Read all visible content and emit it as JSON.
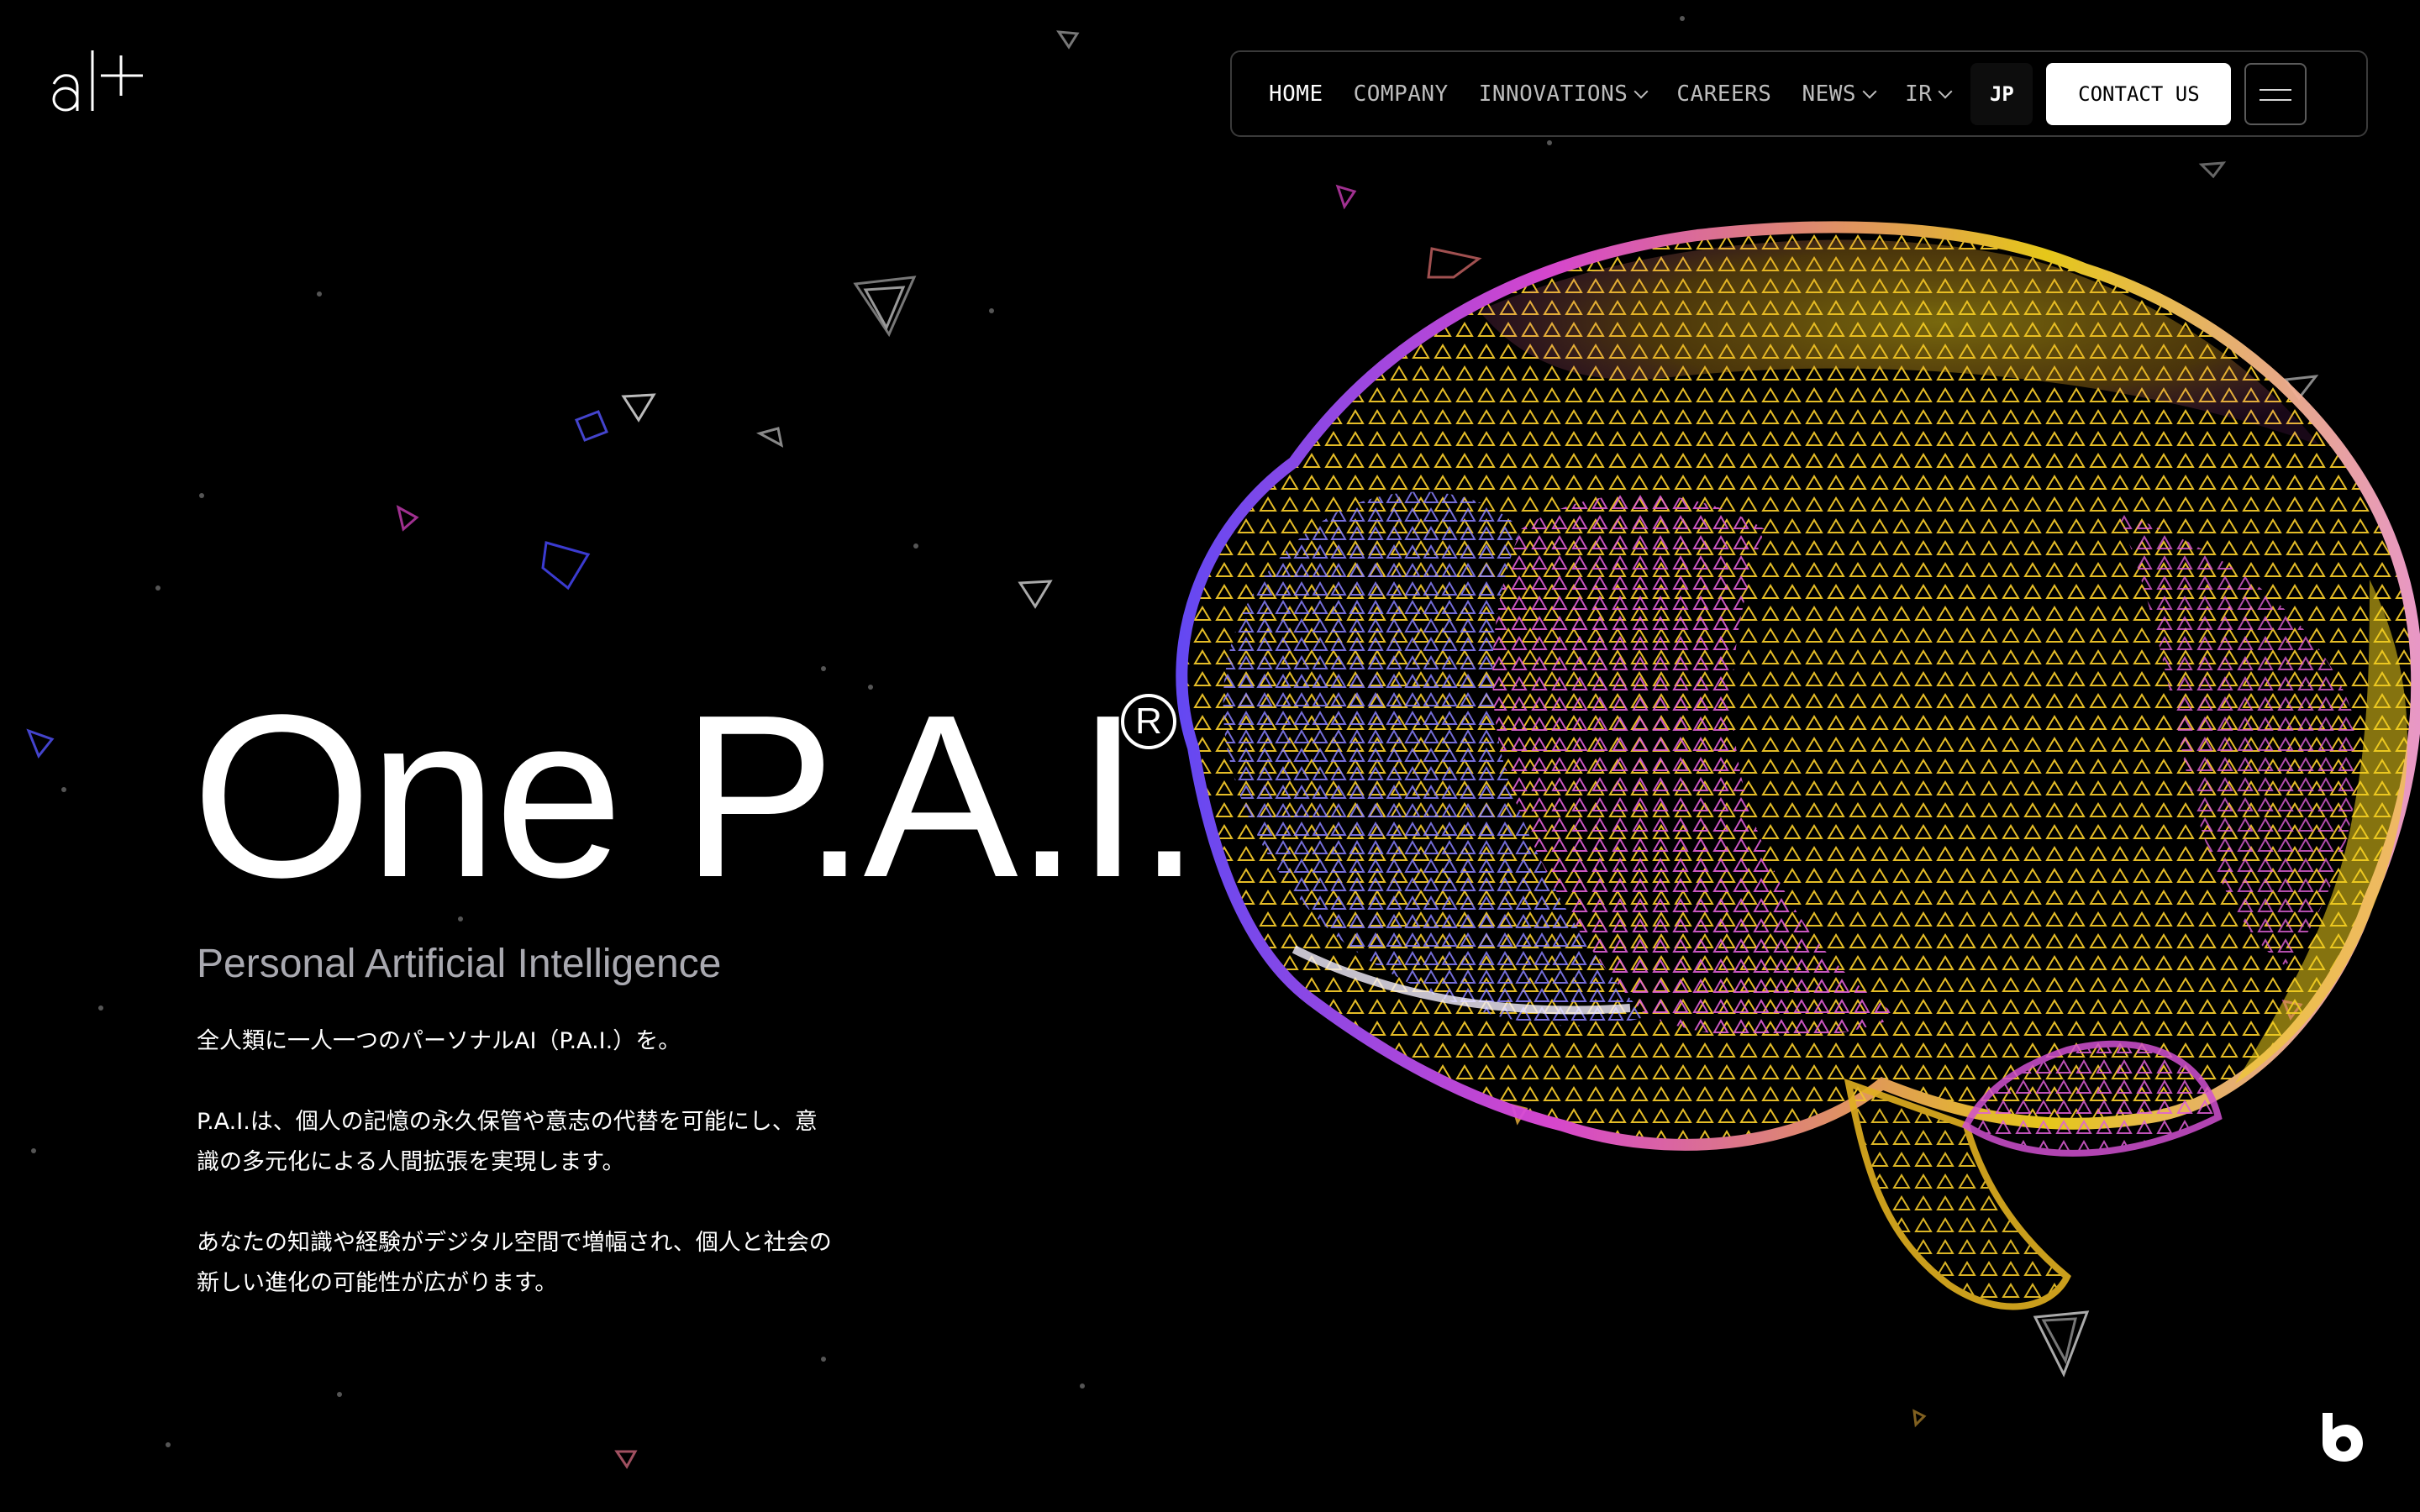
{
  "brand": {
    "logo_text": "al+"
  },
  "nav": {
    "items": [
      {
        "label": "HOME",
        "active": true,
        "has_dropdown": false
      },
      {
        "label": "COMPANY",
        "active": false,
        "has_dropdown": false
      },
      {
        "label": "INNOVATIONS",
        "active": false,
        "has_dropdown": true
      },
      {
        "label": "CAREERS",
        "active": false,
        "has_dropdown": false
      },
      {
        "label": "NEWS",
        "active": false,
        "has_dropdown": true
      },
      {
        "label": "IR",
        "active": false,
        "has_dropdown": true
      }
    ],
    "language_label": "JP",
    "contact_label": "CONTACT US",
    "menu_icon": "hamburger-icon"
  },
  "hero": {
    "title": "One P.A.I.",
    "registered_mark": "R",
    "subtitle": "Personal Artificial Intelligence",
    "paragraphs": [
      "全人類に一人一つのパーソナルAI（P.A.I.）を。",
      "P.A.I.は、個人の記憶の永久保管や意志の代替を可能にし、意識の多元化による人間拡張を実現します。",
      "あなたの知識や経験がデジタル空間で増幅され、個人と社会の新しい進化の可能性が広がります。"
    ]
  },
  "visual": {
    "illustration": "brain-particle-icon",
    "badge_icon": "b-badge-icon"
  },
  "colors": {
    "background": "#000000",
    "accent_yellow": "#f2d21b",
    "accent_magenta": "#e24ad8",
    "accent_violet": "#6a4cff",
    "subtitle_gray": "#a9a9b0"
  }
}
